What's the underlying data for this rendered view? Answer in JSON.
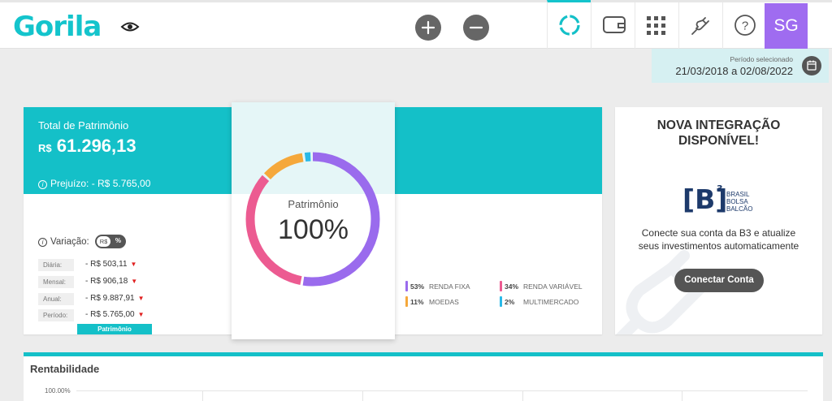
{
  "header": {
    "logo": "Gorila",
    "avatar_initials": "SG",
    "icons": [
      "eye-icon",
      "plus-icon",
      "minus-icon",
      "donut-icon",
      "wallet-icon",
      "grid-icon",
      "plug-icon",
      "help-icon"
    ]
  },
  "period": {
    "label": "Período selecionado",
    "value": "21/03/2018 a 02/08/2022"
  },
  "patrimonio": {
    "title": "Total de Patrimônio",
    "currency": "R$",
    "value": "61.296,13",
    "loss_label": "Prejuízo: - R$ 5.765,00",
    "variacao_label": "Variação:",
    "toggle_left": "R$",
    "toggle_right": "%",
    "rows": [
      {
        "label": "Diária:",
        "value": "- R$ 503,11"
      },
      {
        "label": "Mensal:",
        "value": "- R$ 906,18"
      },
      {
        "label": "Anual:",
        "value": "- R$ 9.887,91"
      },
      {
        "label": "Período:",
        "value": "- R$ 5.765,00"
      }
    ],
    "tab_label": "Patrimônio"
  },
  "chart_data": {
    "type": "pie",
    "center_label": "Patrimônio",
    "center_value": "100%",
    "slices": [
      {
        "name": "RENDA FIXA",
        "percent": 53,
        "label": "53%",
        "color": "#9a6bed"
      },
      {
        "name": "RENDA VARIÁVEL",
        "percent": 34,
        "label": "34%",
        "color": "#ec5b91"
      },
      {
        "name": "MOEDAS",
        "percent": 11,
        "label": "11%",
        "color": "#f5a83b"
      },
      {
        "name": "MULTIMERCADO",
        "percent": 2,
        "label": "2%",
        "color": "#29b9e8"
      }
    ]
  },
  "integration": {
    "title_line1": "NOVA INTEGRAÇÃO",
    "title_line2": "DISPONÍVEL!",
    "logo_mark": "[B]",
    "logo_sup": "3",
    "logo_lines": [
      "BRASIL",
      "BOLSA",
      "BALCÃO"
    ],
    "text_line1": "Conecte sua conta da B3 e atualize",
    "text_line2": "seus investimentos automaticamente",
    "button": "Conectar Conta"
  },
  "rentabilidade": {
    "title": "Rentabilidade",
    "tick": "100.00%"
  },
  "colors": {
    "accent": "#14c0c8",
    "avatar": "#9f6cf0",
    "loss": "#e02020"
  }
}
